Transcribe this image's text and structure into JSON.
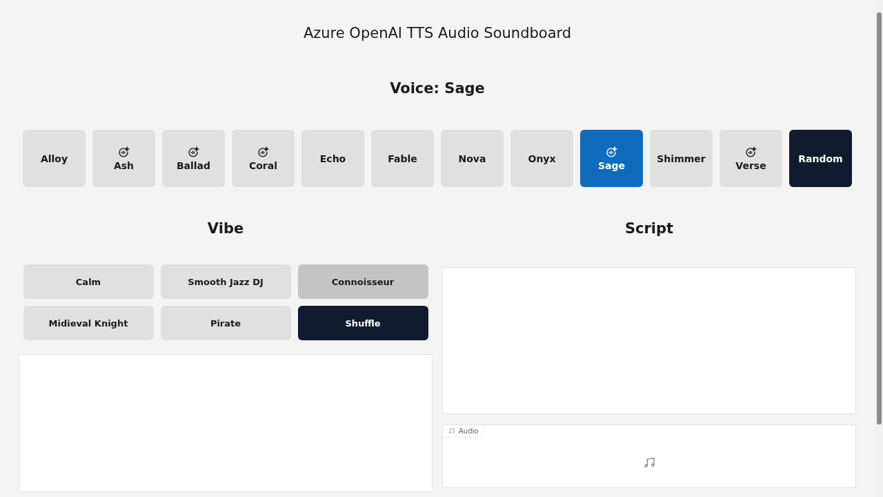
{
  "title": "Azure OpenAI TTS Audio Soundboard",
  "voice_heading": "Voice: Sage",
  "voices": [
    {
      "label": "Alloy",
      "kind": "plain",
      "selected": false
    },
    {
      "label": "Ash",
      "kind": "sparkle",
      "selected": false
    },
    {
      "label": "Ballad",
      "kind": "sparkle",
      "selected": false
    },
    {
      "label": "Coral",
      "kind": "sparkle",
      "selected": false
    },
    {
      "label": "Echo",
      "kind": "plain",
      "selected": false
    },
    {
      "label": "Fable",
      "kind": "plain",
      "selected": false
    },
    {
      "label": "Nova",
      "kind": "plain",
      "selected": false
    },
    {
      "label": "Onyx",
      "kind": "plain",
      "selected": false
    },
    {
      "label": "Sage",
      "kind": "sparkle",
      "selected": true
    },
    {
      "label": "Shimmer",
      "kind": "plain",
      "selected": false
    },
    {
      "label": "Verse",
      "kind": "sparkle",
      "selected": false
    },
    {
      "label": "Random",
      "kind": "action",
      "selected": false
    }
  ],
  "vibe": {
    "heading": "Vibe",
    "options": [
      {
        "label": "Calm",
        "kind": "plain",
        "hovered": false
      },
      {
        "label": "Smooth Jazz DJ",
        "kind": "plain",
        "hovered": false
      },
      {
        "label": "Connoisseur",
        "kind": "plain",
        "hovered": true
      },
      {
        "label": "Midieval Knight",
        "kind": "plain",
        "hovered": false
      },
      {
        "label": "Pirate",
        "kind": "plain",
        "hovered": false
      },
      {
        "label": "Shuffle",
        "kind": "action",
        "hovered": false
      }
    ]
  },
  "script": {
    "heading": "Script"
  },
  "audio": {
    "label": "Audio"
  }
}
